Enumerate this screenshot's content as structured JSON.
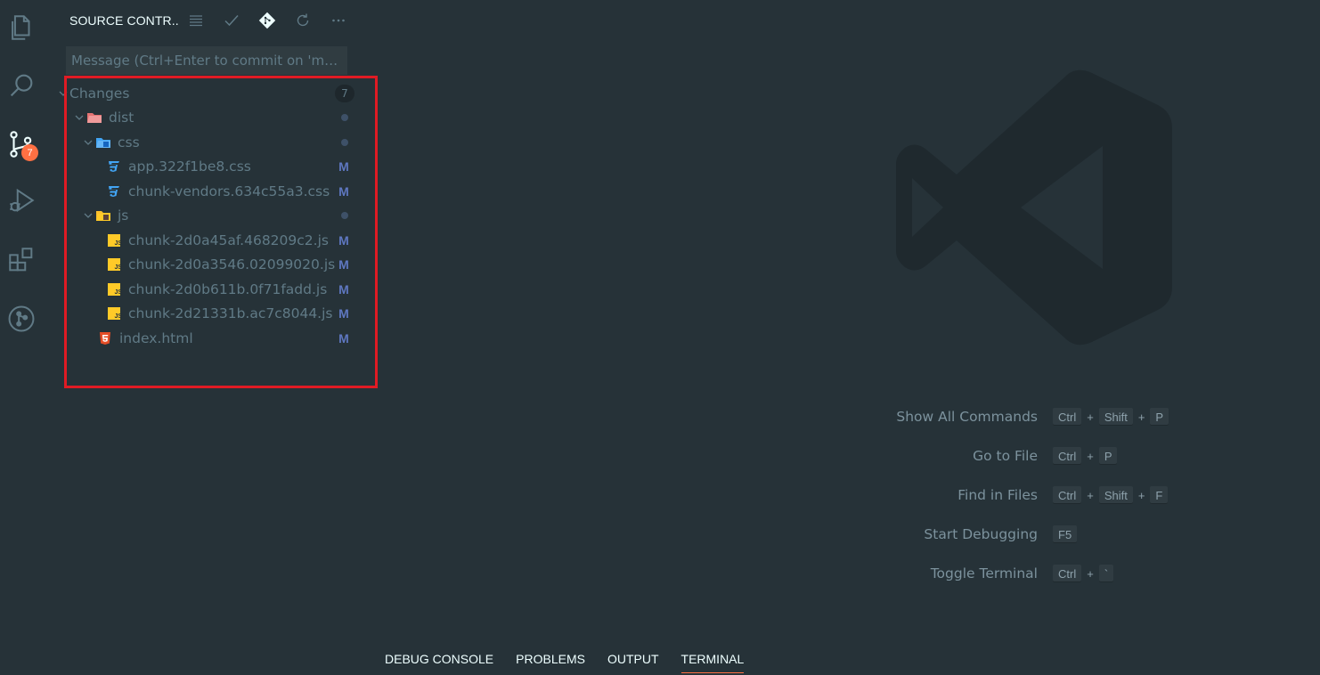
{
  "sidebar": {
    "title": "SOURCE CONTR...",
    "scm_badge": "7",
    "commit_placeholder": "Message (Ctrl+Enter to commit on 'mast..."
  },
  "changes": {
    "label": "Changes",
    "count": "7",
    "folders": {
      "dist": "dist",
      "css": "css",
      "js": "js"
    },
    "files": {
      "css1": {
        "name": "app.322f1be8.css",
        "status": "M"
      },
      "css2": {
        "name": "chunk-vendors.634c55a3.css",
        "status": "M"
      },
      "js1": {
        "name": "chunk-2d0a45af.468209c2.js",
        "status": "M"
      },
      "js2": {
        "name": "chunk-2d0a3546.02099020.js",
        "status": "M"
      },
      "js3": {
        "name": "chunk-2d0b611b.0f71fadd.js",
        "status": "M"
      },
      "js4": {
        "name": "chunk-2d21331b.ac7c8044.js",
        "status": "M"
      },
      "html": {
        "name": "index.html",
        "status": "M"
      }
    }
  },
  "shortcuts": [
    {
      "label": "Show All Commands",
      "keys": [
        "Ctrl",
        "Shift",
        "P"
      ]
    },
    {
      "label": "Go to File",
      "keys": [
        "Ctrl",
        "P"
      ]
    },
    {
      "label": "Find in Files",
      "keys": [
        "Ctrl",
        "Shift",
        "F"
      ]
    },
    {
      "label": "Start Debugging",
      "keys": [
        "F5"
      ]
    },
    {
      "label": "Toggle Terminal",
      "keys": [
        "Ctrl",
        "`"
      ]
    }
  ],
  "plus_sign": "+",
  "panel_tabs": [
    "DEBUG CONSOLE",
    "PROBLEMS",
    "OUTPUT",
    "TERMINAL"
  ],
  "colors": {
    "background": "#263238",
    "accent": "#ff7043",
    "highlight_box": "#e01b24",
    "modified": "#5e77c0"
  },
  "icons": {
    "activity": [
      "explorer-icon",
      "search-icon",
      "source-control-icon",
      "run-debug-icon",
      "extensions-icon",
      "git-graph-icon"
    ],
    "header_actions": [
      "view-as-list-icon",
      "commit-check-icon",
      "git-icon",
      "refresh-icon",
      "more-actions-icon"
    ]
  }
}
